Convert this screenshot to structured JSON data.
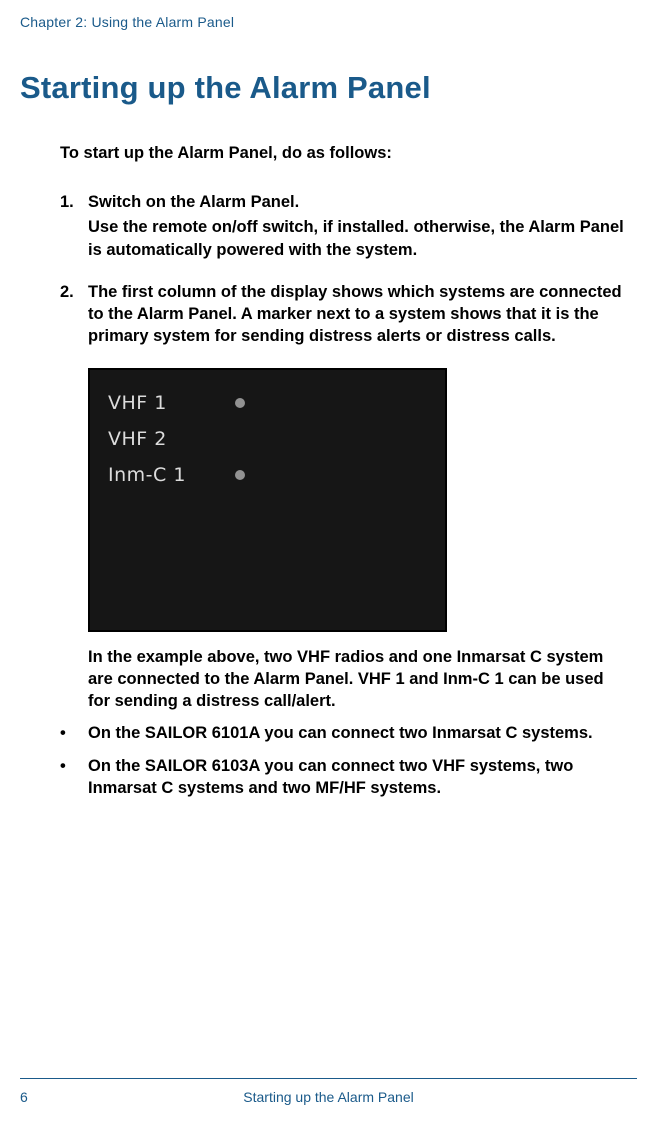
{
  "header": {
    "chapter": "Chapter 2:  Using the Alarm Panel"
  },
  "title": "Starting up the Alarm Panel",
  "intro": "To start up the Alarm Panel, do as follows:",
  "step1": {
    "num": "1.",
    "heading": "Switch on the Alarm Panel.",
    "body": "Use the remote on/off switch, if installed. otherwise, the Alarm Panel is automatically powered with the system."
  },
  "step2": {
    "num": "2.",
    "body": "The first column of the display shows which systems are connected to the Alarm Panel. A marker next to a system shows that it is the primary system for sending distress alerts or distress calls."
  },
  "display": {
    "rows": [
      {
        "label": "VHF 1",
        "marker": true
      },
      {
        "label": "VHF 2",
        "marker": false
      },
      {
        "label": "Inm-C 1",
        "marker": true
      }
    ]
  },
  "caption": "In the example above, two VHF radios and one Inmarsat C system are connected to the Alarm Panel. VHF 1 and Inm-C 1 can be used for sending a distress call/alert.",
  "bullets": [
    "On the SAILOR 6101A you can connect two Inmarsat C systems.",
    "On the SAILOR 6103A you can connect two VHF systems, two Inmarsat C systems and two MF/HF systems."
  ],
  "footer": {
    "page": "6",
    "title": "Starting up the Alarm Panel"
  }
}
